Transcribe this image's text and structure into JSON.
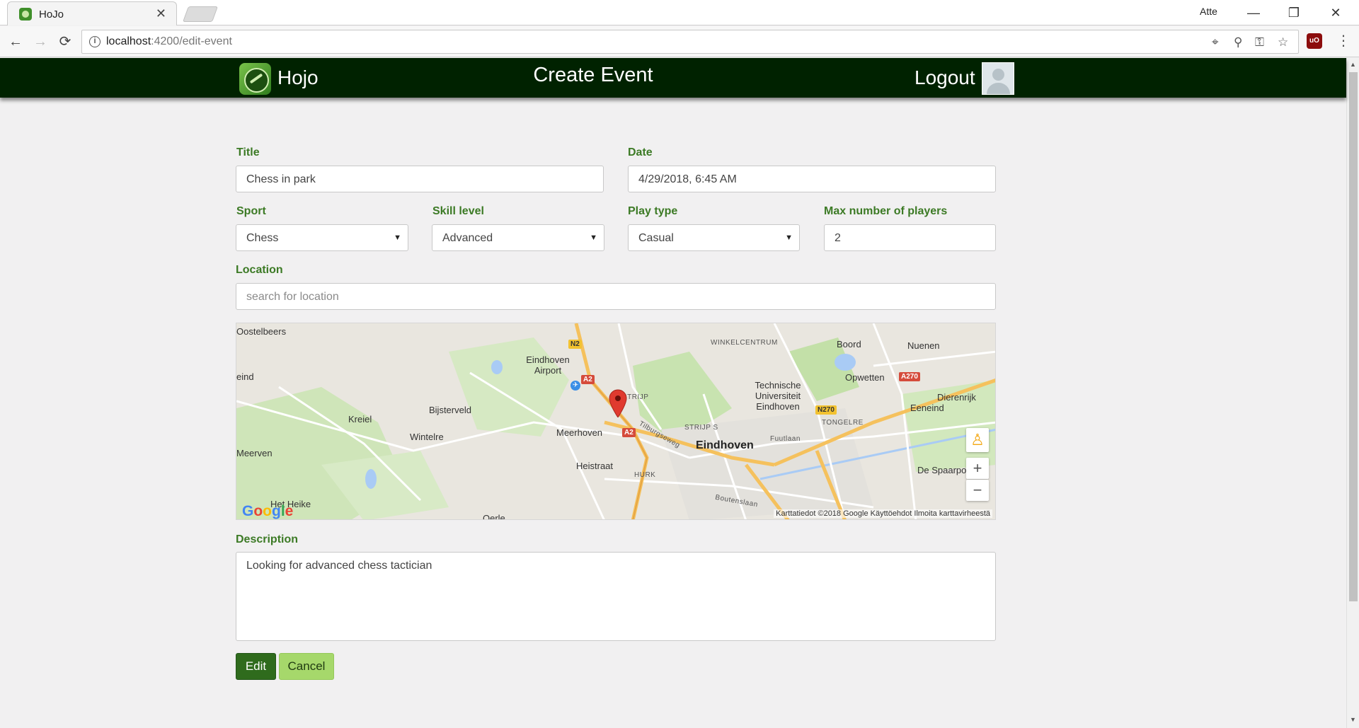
{
  "browser": {
    "tab_title": "HoJo",
    "tab_close": "✕",
    "user_name": "Atte",
    "url_host": "localhost",
    "url_path": ":4200/edit-event",
    "window_buttons": {
      "minimize": "—",
      "restore": "❐",
      "close": "✕"
    },
    "nav": {
      "back": "←",
      "forward": "→",
      "reload": "⟳"
    },
    "extension_badge": "uO"
  },
  "header": {
    "brand": "Hojo",
    "page_title": "Create Event",
    "logout_label": "Logout"
  },
  "form": {
    "title": {
      "label": "Title",
      "value": "Chess in park"
    },
    "date": {
      "label": "Date",
      "value": "4/29/2018, 6:45 AM"
    },
    "sport": {
      "label": "Sport",
      "value": "Chess"
    },
    "skill_level": {
      "label": "Skill level",
      "value": "Advanced"
    },
    "play_type": {
      "label": "Play type",
      "value": "Casual"
    },
    "max_players": {
      "label": "Max number of players",
      "value": "2"
    },
    "location": {
      "label": "Location",
      "placeholder": "search for location"
    },
    "description": {
      "label": "Description",
      "value": "Looking for advanced chess tactician"
    },
    "edit_label": "Edit",
    "cancel_label": "Cancel"
  },
  "map": {
    "places": {
      "oostelbeers": "Oostelbeers",
      "airport": "Eindhoven Airport",
      "winkelcentrum": "WINKELCENTRUM",
      "boord": "Boord",
      "nuenen": "Nuenen",
      "eind": "eind",
      "kreiel": "Kreiel",
      "bijsterveld": "Bijsterveld",
      "wintelre": "Wintelre",
      "meerhoven": "Meerhoven",
      "tu": "Technische Universiteit Eindhoven",
      "opwetten": "Opwetten",
      "dierenrijk": "Dierenrijk",
      "eeneind": "Eeneind",
      "tongelre": "TONGELRE",
      "strijp_s": "STRIJP S",
      "strijp": "STRIJP",
      "eindhoven": "Eindhoven",
      "heistraat": "Heistraat",
      "hurk": "HURK",
      "meerven": "Meerven",
      "heike": "Het Heike",
      "oerle": "Oerle",
      "de_spaarpot": "De Spaarpot",
      "tilburgseweg": "Tilburgseweg",
      "boutenslaan": "Boutenslaan",
      "fuutlaan": "Fuutlaan"
    },
    "roads": {
      "n2": "N2",
      "a2_top": "A2",
      "a2_bottom": "A2",
      "a270": "A270",
      "n270": "N270"
    },
    "zoom_in": "+",
    "zoom_out": "−",
    "credits": "Karttatiedot ©2018 Google   Käyttöehdot   Ilmoita karttavirheestä",
    "colors": {
      "water": "#a9cbf5",
      "park": "#cde6b8",
      "highway": "#f5c15d",
      "marker": "#e03a2f"
    }
  },
  "colors": {
    "header_bg": "#002200",
    "label": "#3c7a25",
    "edit_button": "#2f6b1d",
    "cancel_button": "#a6d86b"
  }
}
